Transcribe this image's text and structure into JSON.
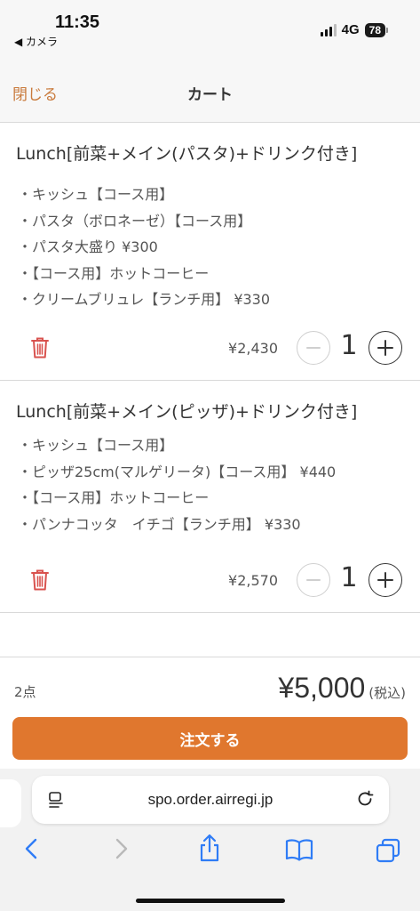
{
  "status_bar": {
    "time": "11:35",
    "back_app": "◀ カメラ",
    "network": "4G",
    "battery": "78"
  },
  "header": {
    "close_label": "閉じる",
    "title": "カート"
  },
  "cart": {
    "items": [
      {
        "name": "Lunch[前菜+メイン(パスタ)+ドリンク付き]",
        "options": [
          "・キッシュ【コース用】",
          "・パスタ（ボロネーゼ）【コース用】",
          "・パスタ大盛り ¥300",
          "・【コース用】ホットコーヒー",
          "・クリームブリュレ【ランチ用】 ¥330"
        ],
        "price": "¥2,430",
        "quantity": "1"
      },
      {
        "name": "Lunch[前菜+メイン(ピッザ)+ドリンク付き]",
        "options": [
          "・キッシュ【コース用】",
          "・ピッザ25cm(マルゲリータ)【コース用】 ¥440",
          "・【コース用】ホットコーヒー",
          "・パンナコッタ　イチゴ【ランチ用】 ¥330"
        ],
        "price": "¥2,570",
        "quantity": "1"
      }
    ]
  },
  "summary": {
    "count": "2点",
    "total": "¥5,000",
    "tax_note": "(税込)",
    "order_button": "注文する"
  },
  "browser": {
    "url": "spo.order.airregi.jp"
  },
  "colors": {
    "accent": "#e0772e",
    "close_link": "#c97a3c",
    "trash": "#d9534f",
    "ios_blue": "#2f7cf6"
  }
}
